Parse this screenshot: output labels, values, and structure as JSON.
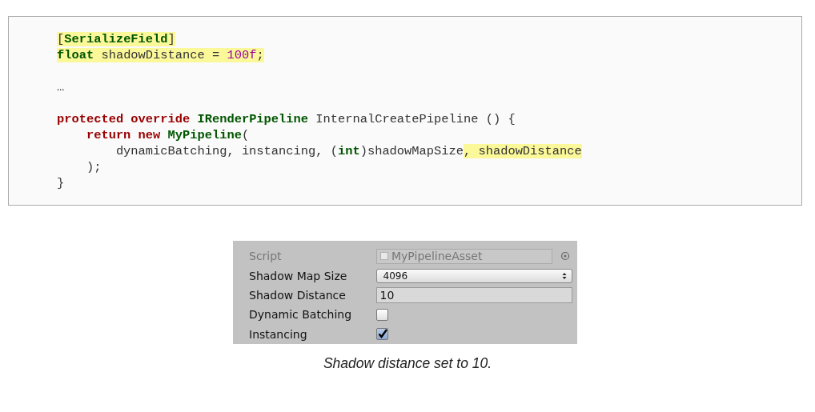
{
  "code_block": {
    "lines": [
      {
        "tokens": [
          {
            "text": "[",
            "kind": "plain",
            "highlight": true
          },
          {
            "text": "SerializeField",
            "kind": "type",
            "highlight": true
          },
          {
            "text": "]",
            "kind": "plain",
            "highlight": true
          }
        ]
      },
      {
        "tokens": [
          {
            "text": "float",
            "kind": "type",
            "highlight": true
          },
          {
            "text": " shadowDistance = ",
            "kind": "plain",
            "highlight": true
          },
          {
            "text": "100f",
            "kind": "number",
            "highlight": true
          },
          {
            "text": ";",
            "kind": "plain",
            "highlight": true
          }
        ]
      },
      {
        "kind": "blank"
      },
      {
        "tokens": [
          {
            "text": "…",
            "kind": "plain",
            "highlight": false
          }
        ]
      },
      {
        "kind": "blank"
      },
      {
        "tokens": [
          {
            "text": "protected override ",
            "kind": "keyword",
            "highlight": false
          },
          {
            "text": "IRenderPipeline",
            "kind": "type",
            "highlight": false
          },
          {
            "text": " InternalCreatePipeline () {",
            "kind": "plain",
            "highlight": false
          }
        ],
        "children": [
          {
            "tokens": [
              {
                "text": "return new ",
                "kind": "keyword",
                "highlight": false
              },
              {
                "text": "MyPipeline",
                "kind": "type",
                "highlight": false
              },
              {
                "text": "(",
                "kind": "plain",
                "highlight": false
              }
            ],
            "children": [
              {
                "tokens": [
                  {
                    "text": "dynamicBatching, instancing, (",
                    "kind": "plain",
                    "highlight": false
                  },
                  {
                    "text": "int",
                    "kind": "type",
                    "highlight": false
                  },
                  {
                    "text": ")shadowMapSize",
                    "kind": "plain",
                    "highlight": false
                  },
                  {
                    "text": ", shadowDistance",
                    "kind": "plain",
                    "highlight": true
                  }
                ]
              }
            ]
          },
          {
            "tokens": [
              {
                "text": ");",
                "kind": "plain",
                "highlight": false
              }
            ]
          }
        ]
      },
      {
        "tokens": [
          {
            "text": "}",
            "kind": "plain",
            "highlight": false
          }
        ]
      }
    ]
  },
  "inspector": {
    "rows": [
      {
        "label": "Script",
        "kind": "object",
        "value": "MyPipelineAsset",
        "disabled": true
      },
      {
        "label": "Shadow Map Size",
        "kind": "dropdown",
        "value": "4096",
        "disabled": false
      },
      {
        "label": "Shadow Distance",
        "kind": "number",
        "value": "10",
        "disabled": false
      },
      {
        "label": "Dynamic Batching",
        "kind": "checkbox",
        "checked": false,
        "disabled": false
      },
      {
        "label": "Instancing",
        "kind": "checkbox",
        "checked": true,
        "disabled": false
      }
    ]
  },
  "caption": "Shadow distance set to 10."
}
